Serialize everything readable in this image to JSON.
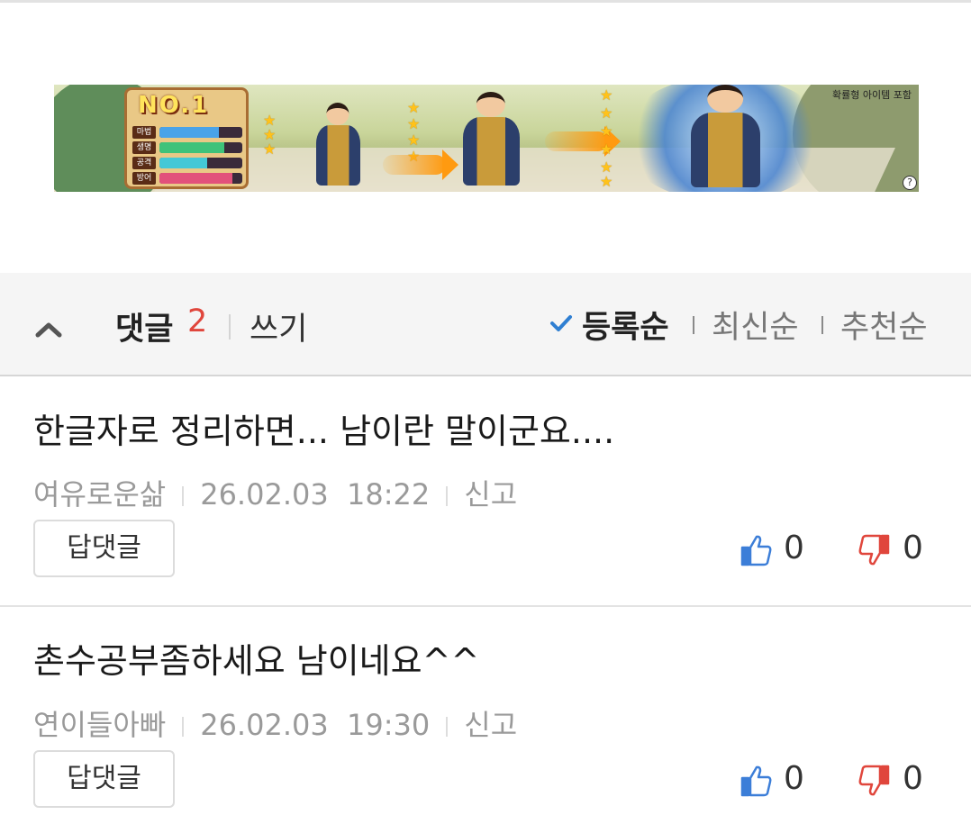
{
  "ad": {
    "board_title": "NO.1",
    "stats": [
      {
        "label": "마법",
        "fill": 0.72,
        "color": "#4aa3e8"
      },
      {
        "label": "생명",
        "fill": 0.78,
        "color": "#3fc27a"
      },
      {
        "label": "공격",
        "fill": 0.58,
        "color": "#44c8d6"
      },
      {
        "label": "방어",
        "fill": 0.88,
        "color": "#e2517b"
      }
    ],
    "note": "확률형 아이템 포함",
    "help": "?"
  },
  "comments_header": {
    "title": "댓글",
    "count": "2",
    "write_label": "쓰기",
    "sort_options": [
      "등록순",
      "최신순",
      "추천순"
    ],
    "active_sort": "등록순"
  },
  "comments": [
    {
      "text": "한글자로 정리하면... 남이란 말이군요....",
      "author": "여유로운삶",
      "date": "26.02.03",
      "time": "18:22",
      "report": "신고",
      "reply": "답댓글",
      "likes": "0",
      "dislikes": "0"
    },
    {
      "text": "촌수공부좀하세요 남이네요^^",
      "author": "연이들아빠",
      "date": "26.02.03",
      "time": "19:30",
      "report": "신고",
      "reply": "답댓글",
      "likes": "0",
      "dislikes": "0"
    }
  ],
  "colors": {
    "count": "#e0463c",
    "check": "#2f7fd2",
    "like": "#3c7ed8",
    "dislike": "#e0463c"
  }
}
